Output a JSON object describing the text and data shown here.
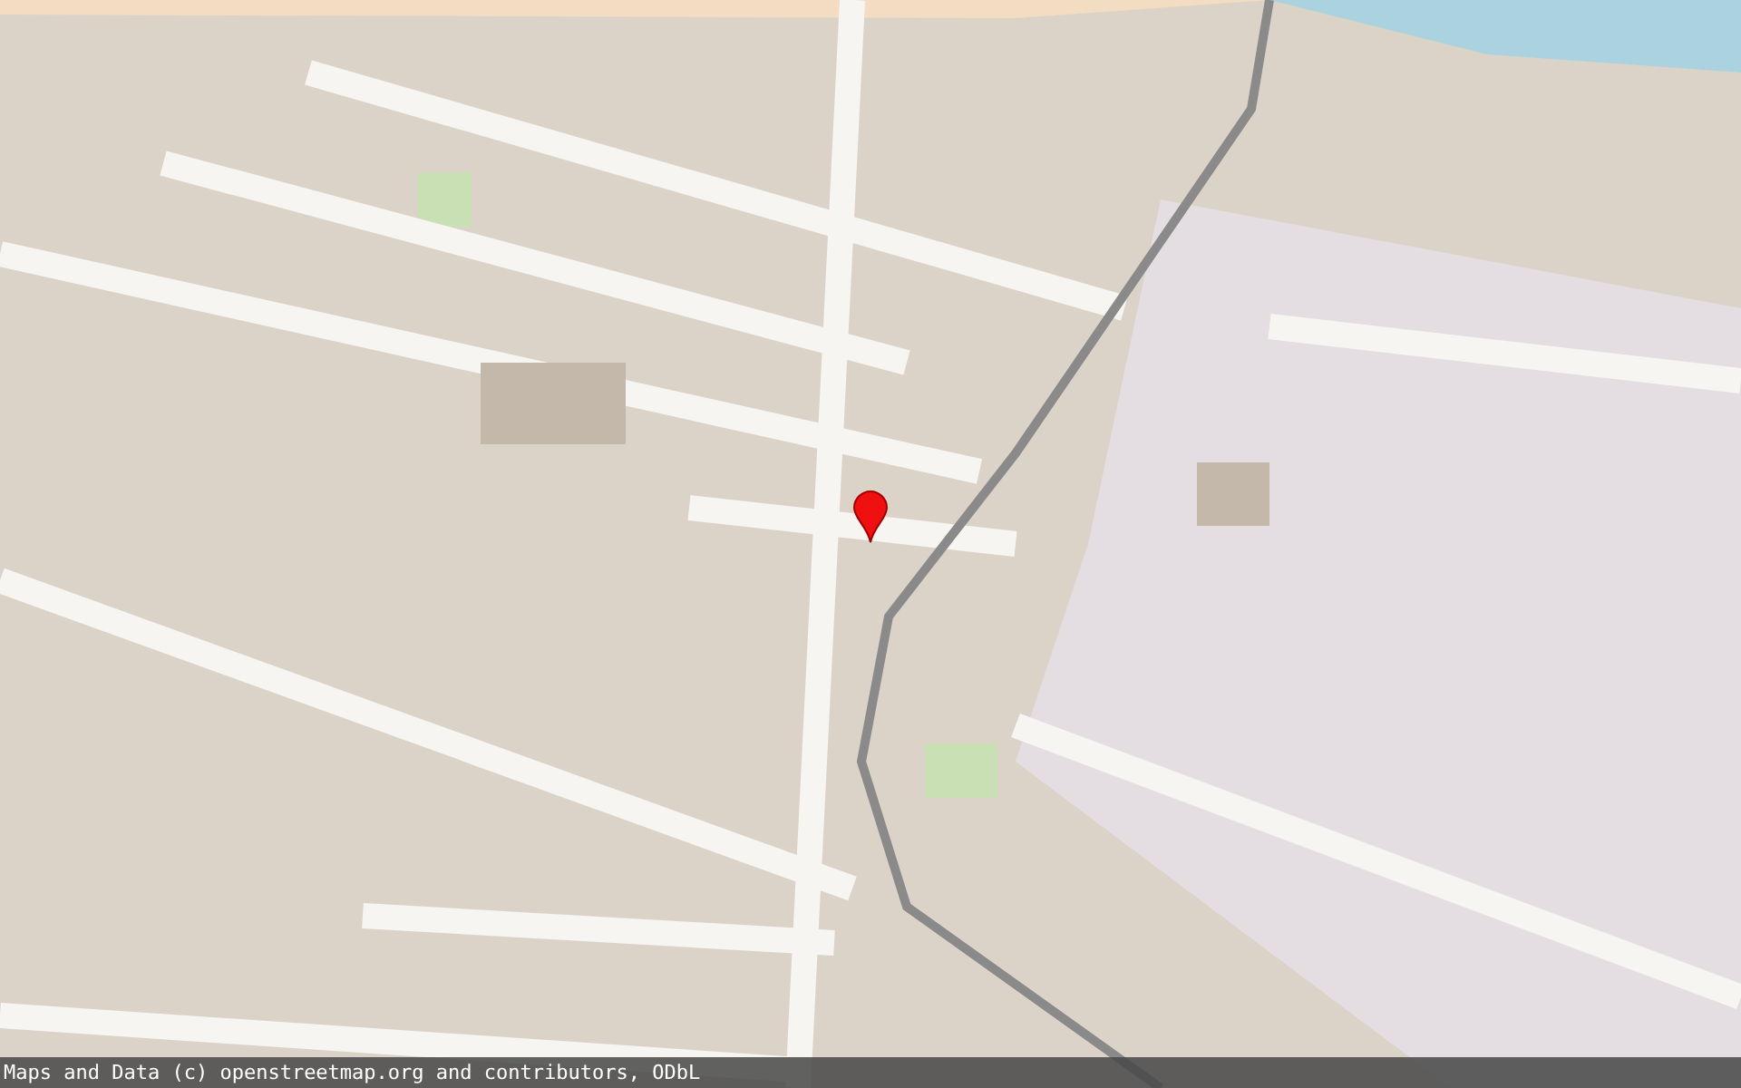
{
  "attribution": "Maps and Data (c) openstreetmap.org and contributors, ODbL"
}
